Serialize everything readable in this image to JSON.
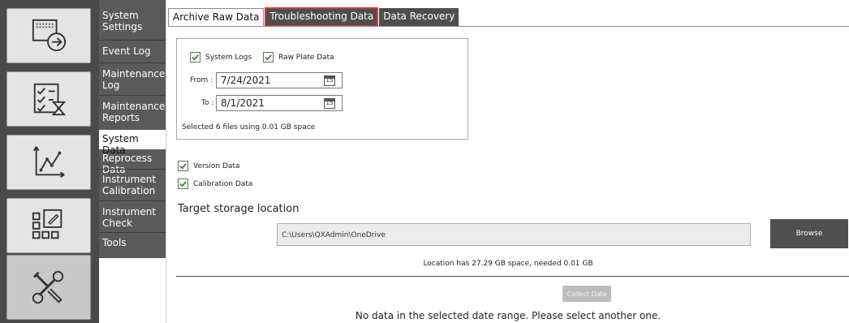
{
  "rail": {
    "icons": [
      "screen-export-icon",
      "checklist-hourglass-icon",
      "line-chart-icon",
      "grid-edit-icon",
      "tools-icon"
    ]
  },
  "menu": {
    "items": [
      {
        "label": "System Settings"
      },
      {
        "label": "Event Log"
      },
      {
        "label": "Maintenance Log"
      },
      {
        "label": "Maintenance Reports"
      },
      {
        "label": "System Data"
      },
      {
        "label": "Reprocess Data"
      },
      {
        "label": "Instrument Calibration"
      },
      {
        "label": "Instrument Check"
      },
      {
        "label": "Tools"
      }
    ],
    "selected": "System Data"
  },
  "tabs": [
    {
      "label": "Archive Raw Data"
    },
    {
      "label": "Troubleshooting Data"
    },
    {
      "label": "Data Recovery"
    }
  ],
  "archive": {
    "system_logs_label": "System Logs",
    "raw_plate_label": "Raw Plate Data",
    "from_label": "From :",
    "from_value": "7/24/2021",
    "to_label": "To :",
    "to_value": "8/1/2021",
    "calendar_glyph": "15",
    "selected_info": "Selected 6 files using 0.01 GB space"
  },
  "extras": {
    "version_label": "Version Data",
    "calibration_label": "Calibration Data"
  },
  "storage": {
    "title": "Target storage location",
    "path": "C:\\Users\\QXAdmin\\OneDrive",
    "browse_label": "Browse",
    "space_info": "Location has 27.29 GB space, needed 0.01 GB"
  },
  "collect_label": "Collect Data",
  "message": "No data in the selected date range. Please select another one.",
  "colors": {
    "rail_bg": "#4a4a4a",
    "menu_bg": "#5a5a5a",
    "checkbox_green": "#3b8f2f",
    "highlight_red": "#e0342c"
  }
}
